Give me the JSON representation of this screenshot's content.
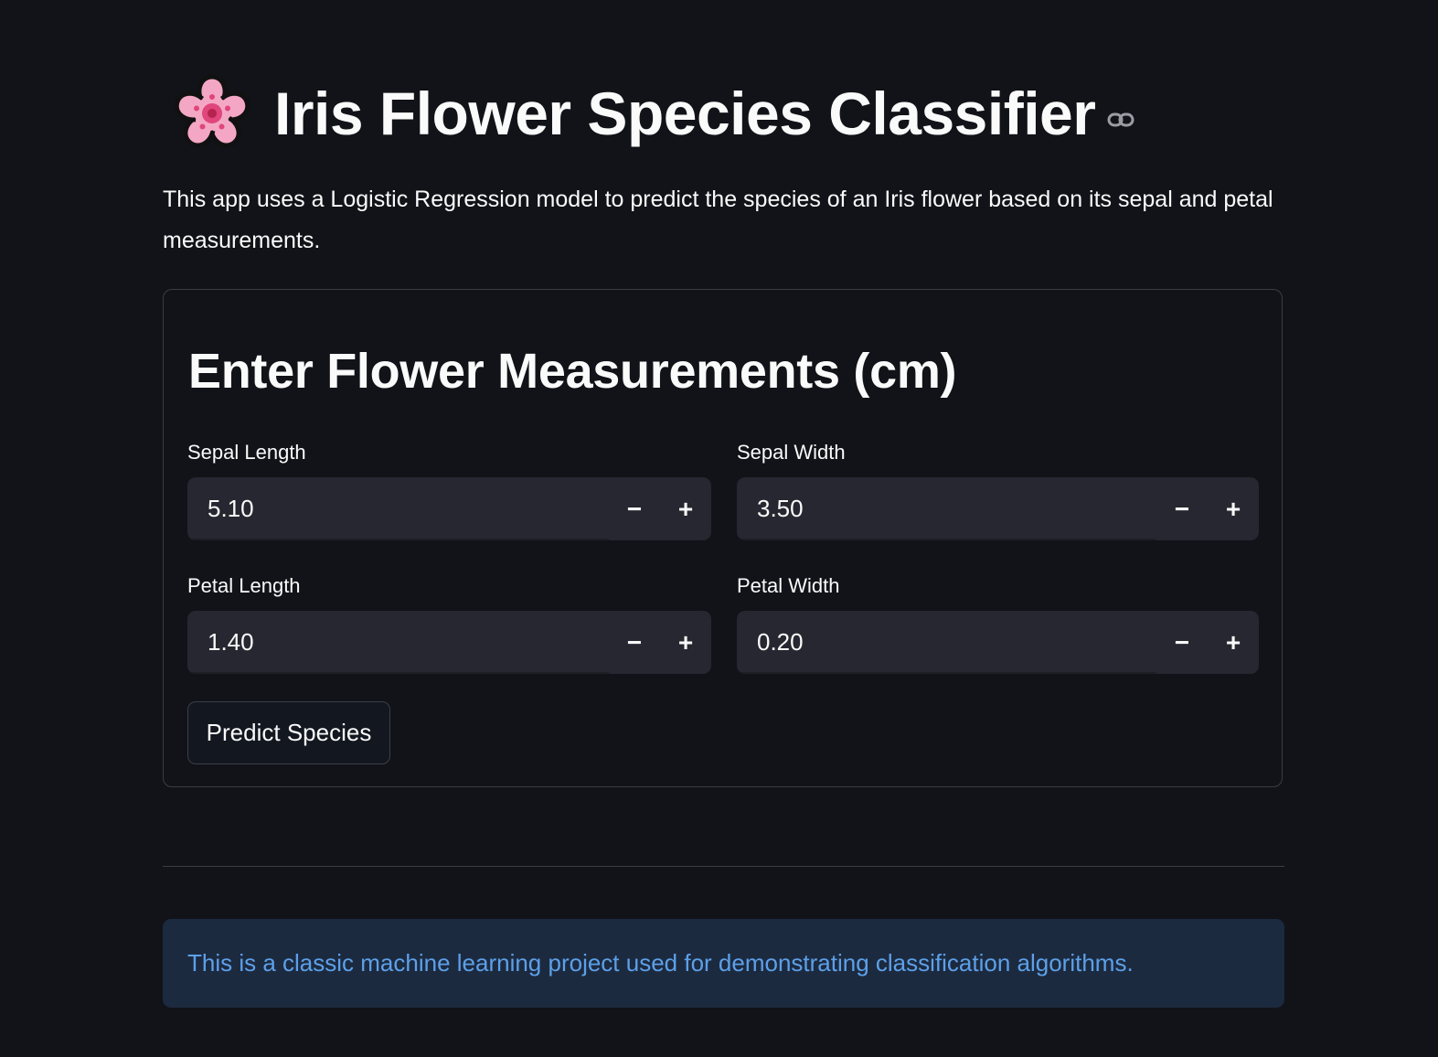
{
  "header": {
    "icon": "cherry-blossom-icon",
    "title": "Iris Flower Species Classifier",
    "anchor_icon": "link-icon"
  },
  "description": "This app uses a Logistic Regression model to predict the species of an Iris flower based on its sepal and petal measurements.",
  "form": {
    "heading": "Enter Flower Measurements (cm)",
    "fields": [
      {
        "label": "Sepal Length",
        "value": "5.10",
        "decrement": "−",
        "increment": "+"
      },
      {
        "label": "Sepal Width",
        "value": "3.50",
        "decrement": "−",
        "increment": "+"
      },
      {
        "label": "Petal Length",
        "value": "1.40",
        "decrement": "−",
        "increment": "+"
      },
      {
        "label": "Petal Width",
        "value": "0.20",
        "decrement": "−",
        "increment": "+"
      }
    ],
    "submit_label": "Predict Species"
  },
  "info": {
    "text": "This is a classic machine learning project used for demonstrating classification algorithms."
  },
  "colors": {
    "background": "#111318",
    "input_bg": "#262730",
    "info_bg": "#1c2a40",
    "info_text": "#5da0e8",
    "border": "#3a3d47"
  }
}
